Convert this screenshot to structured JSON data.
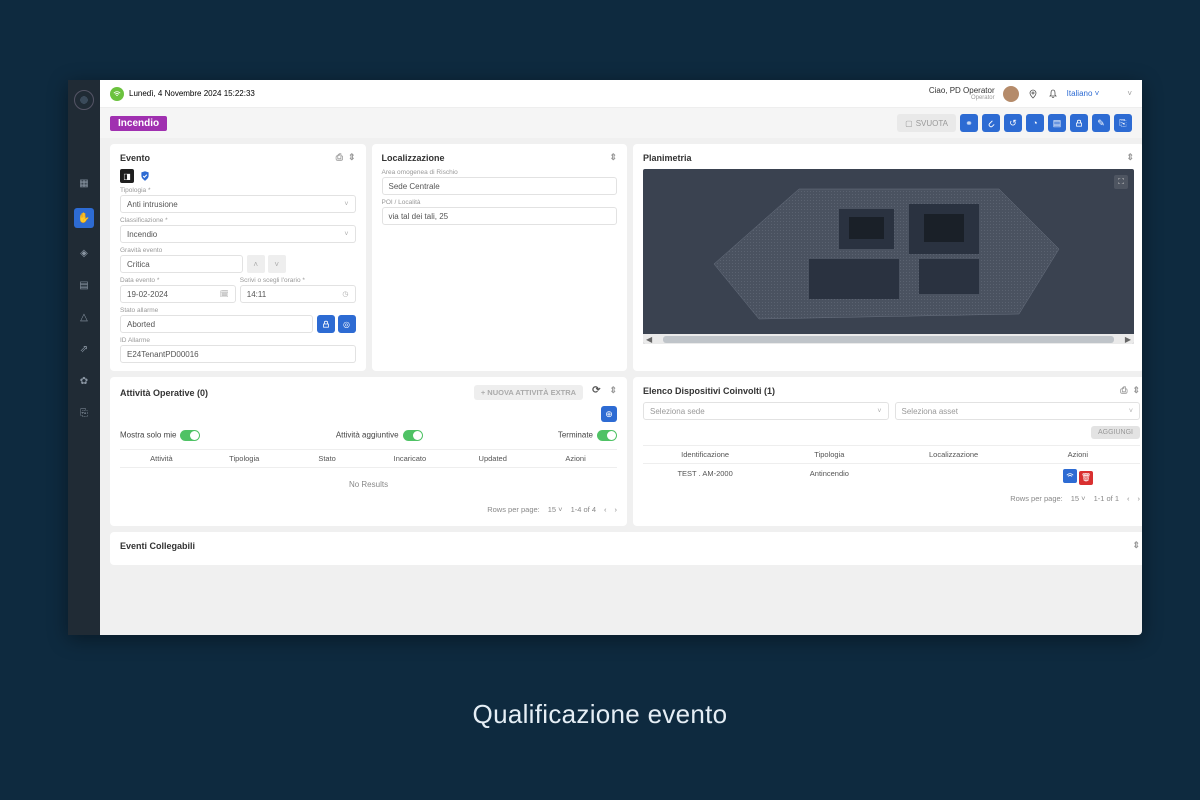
{
  "caption": "Qualificazione evento",
  "topbar": {
    "datetime": "Lunedì, 4 Novembre 2024 15:22:33",
    "greeting": "Ciao, PD Operator",
    "role": "Operator",
    "language": "Italiano"
  },
  "pagehdr": {
    "tag": "Incendio",
    "svuota": "SVUOTA"
  },
  "evento": {
    "title": "Evento",
    "tipologia_label": "Tipologia *",
    "tipologia": "Anti intrusione",
    "classificazione_label": "Classificazione *",
    "classificazione": "Incendio",
    "gravita_label": "Gravità evento",
    "gravita": "Critica",
    "data_label": "Data evento *",
    "data": "19-02-2024",
    "ora_label": "Scrivi o scegli l'orario *",
    "ora": "14:11",
    "stato_label": "Stato allarme",
    "stato": "Aborted",
    "id_label": "ID Allarme",
    "id": "E24TenantPD00016"
  },
  "localizzazione": {
    "title": "Localizzazione",
    "area_label": "Area omogenea di Rischio",
    "area": "Sede Centrale",
    "poi_label": "POI / Località",
    "poi": "via tal dei tali, 25"
  },
  "planimetria": {
    "title": "Planimetria"
  },
  "attivita": {
    "title": "Attività Operative (0)",
    "nuova": "+ NUOVA ATTIVITÀ EXTRA",
    "mostra": "Mostra solo mie",
    "aggiuntive": "Attività aggiuntive",
    "terminate": "Terminate",
    "cols": {
      "attivita": "Attività",
      "tipologia": "Tipologia",
      "stato": "Stato",
      "incaricato": "Incaricato",
      "updated": "Updated",
      "azioni": "Azioni"
    },
    "noresults": "No Results",
    "rows_label": "Rows per page:",
    "rows_value": "15",
    "range": "1-4 of 4"
  },
  "dispositivi": {
    "title": "Elenco Dispositivi Coinvolti (1)",
    "sede_ph": "Seleziona sede",
    "asset_ph": "Seleziona asset",
    "aggiungi": "AGGIUNGI",
    "cols": {
      "identificazione": "Identificazione",
      "tipologia": "Tipologia",
      "localizzazione": "Localizzazione",
      "azioni": "Azioni"
    },
    "row": {
      "id": "TEST . AM-2000",
      "tipo": "Antincendio",
      "loc": ""
    },
    "rows_label": "Rows per page:",
    "rows_value": "15",
    "range": "1-1 of 1"
  },
  "collegabili": {
    "title": "Eventi Collegabili"
  }
}
